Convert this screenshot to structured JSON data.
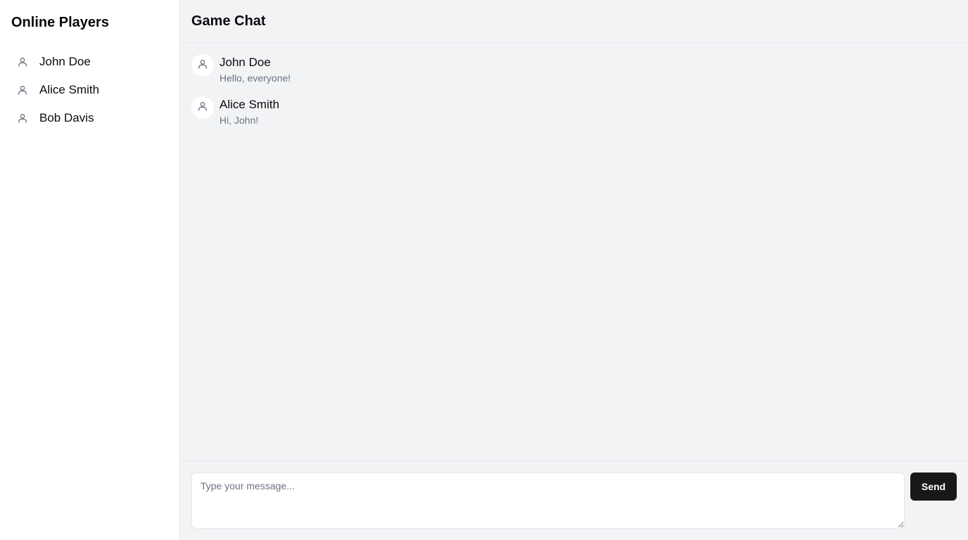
{
  "sidebar": {
    "title": "Online Players",
    "players": [
      {
        "name": "John Doe",
        "icon": "user-icon"
      },
      {
        "name": "Alice Smith",
        "icon": "user-icon"
      },
      {
        "name": "Bob Davis",
        "icon": "user-icon"
      }
    ]
  },
  "chat": {
    "title": "Game Chat",
    "messages": [
      {
        "author": "John Doe",
        "text": "Hello, everyone!",
        "icon": "user-icon"
      },
      {
        "author": "Alice Smith",
        "text": "Hi, John!",
        "icon": "user-icon"
      }
    ]
  },
  "composer": {
    "placeholder": "Type your message...",
    "value": "",
    "send_label": "Send"
  },
  "colors": {
    "sidebar_bg": "#ffffff",
    "main_bg": "#f2f3f5",
    "border": "#e5e7eb",
    "button_bg": "#18181b",
    "button_text": "#ffffff",
    "muted_text": "#6b7280"
  }
}
